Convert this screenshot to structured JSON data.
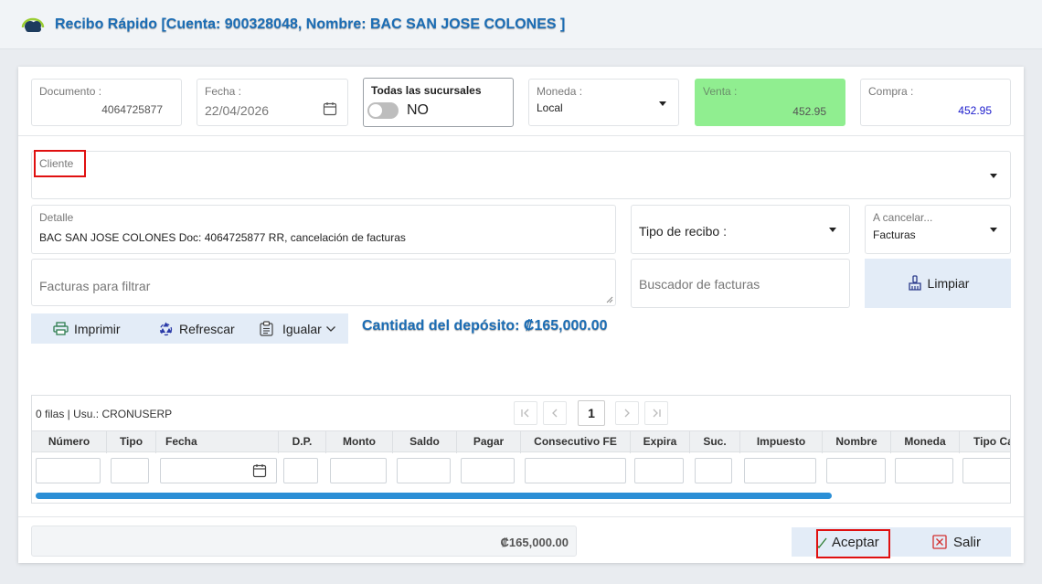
{
  "window": {
    "title": "Recibo Rápido [Cuenta: 900328048, Nombre: BAC SAN JOSE COLONES ]"
  },
  "header": {
    "documento": {
      "label": "Documento :",
      "value": "4064725877"
    },
    "fecha": {
      "label": "Fecha :",
      "value": "22/04/2026"
    },
    "sucursales": {
      "label": "Todas las sucursales",
      "toggle_value": "NO"
    },
    "moneda": {
      "label": "Moneda :",
      "value": "Local"
    },
    "venta": {
      "label": "Venta :",
      "value": "452.95"
    },
    "compra": {
      "label": "Compra :",
      "value": "452.95"
    }
  },
  "cliente": {
    "label": "Cliente",
    "value": ""
  },
  "detalle": {
    "label": "Detalle",
    "value": "BAC SAN JOSE COLONES Doc: 4064725877 RR, cancelación de facturas"
  },
  "tipo_recibo": {
    "label": "Tipo de recibo :"
  },
  "a_cancelar": {
    "label": "A cancelar...",
    "value": "Facturas"
  },
  "facturas_filtrar": {
    "placeholder": "Facturas para filtrar"
  },
  "buscador": {
    "placeholder": "Buscador de facturas"
  },
  "limpiar_label": "Limpiar",
  "toolbar": {
    "imprimir": "Imprimir",
    "refrescar": "Refrescar",
    "igualar": "Igualar"
  },
  "deposit_text": "Cantidad del depósito: ₡165,000.00",
  "grid": {
    "info": "0 filas | Usu.: CRONUSERP",
    "page": "1",
    "columns": [
      "Número",
      "Tipo",
      "Fecha",
      "D.P.",
      "Monto",
      "Saldo",
      "Pagar",
      "Consecutivo FE",
      "Expira",
      "Suc.",
      "Impuesto",
      "Nombre",
      "Moneda",
      "Tipo Ca"
    ]
  },
  "footer": {
    "total": "₡165,000.00",
    "aceptar": "Aceptar",
    "salir": "Salir"
  },
  "colors": {
    "accent": "#1b6db5",
    "venta_bg": "#90ee90",
    "highlight": "#e01010",
    "scroll": "#2b8fd6"
  }
}
